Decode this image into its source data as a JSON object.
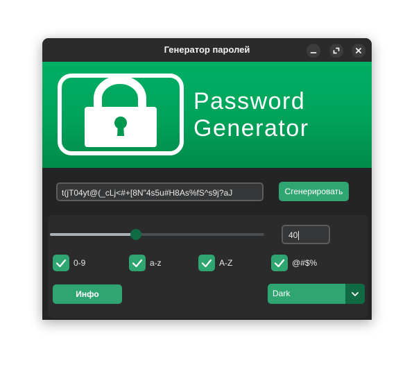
{
  "window": {
    "title": "Генератор паролей"
  },
  "banner": {
    "line1": "Password",
    "line2": "Generator",
    "icon": "padlock-icon"
  },
  "password": {
    "value": "t(jT04yt@(_cLj<#+[8N\"4s5u#H8As%fS^s9j?aJ"
  },
  "generate_button": {
    "label": "Сгенерировать"
  },
  "slider": {
    "value_fraction": 0.4
  },
  "length_field": {
    "value": "40"
  },
  "checkboxes": [
    {
      "label": "0-9",
      "checked": true
    },
    {
      "label": "a-z",
      "checked": true
    },
    {
      "label": "A-Z",
      "checked": true
    },
    {
      "label": "@#$%",
      "checked": true
    }
  ],
  "info_button": {
    "label": "Инфо"
  },
  "theme_dropdown": {
    "value": "Dark"
  },
  "colors": {
    "accent": "#2fa572",
    "accent_dark": "#106a43",
    "banner_green": "#00a25a",
    "window_bg": "#242424"
  }
}
